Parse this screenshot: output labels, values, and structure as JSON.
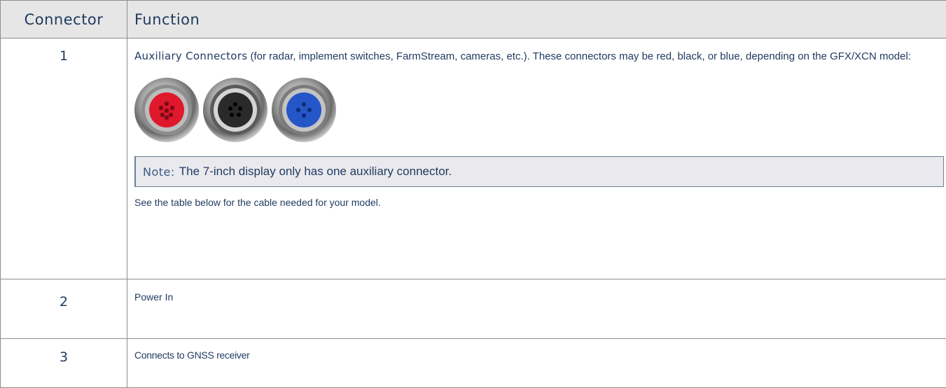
{
  "table": {
    "headers": {
      "connector": "Connector",
      "function": "Function"
    },
    "rows": [
      {
        "number": "1",
        "aux_term": "Auxiliary Connectors",
        "aux_text": " (for radar, implement switches, FarmStream, cameras, etc.). These connectors may be red, black, or blue, depending on the GFX/XCN model:",
        "connector_images": [
          {
            "name": "red-connector",
            "color": "#e0182c"
          },
          {
            "name": "black-connector",
            "color": "#2a2a2a"
          },
          {
            "name": "blue-connector",
            "color": "#2456c8"
          }
        ],
        "note_label": "Note:",
        "note_text": "The 7-inch display only has one auxiliary connector.",
        "footer_text": "See the table below for the cable needed for your model."
      },
      {
        "number": "2",
        "text": "Power In"
      },
      {
        "number": "3",
        "text": "Connects to GNSS receiver"
      }
    ]
  },
  "colors": {
    "text": "#1f3a5f",
    "header_bg": "#e6e6e6",
    "note_bg": "#e9e9ee",
    "border": "#8c8c8c"
  }
}
